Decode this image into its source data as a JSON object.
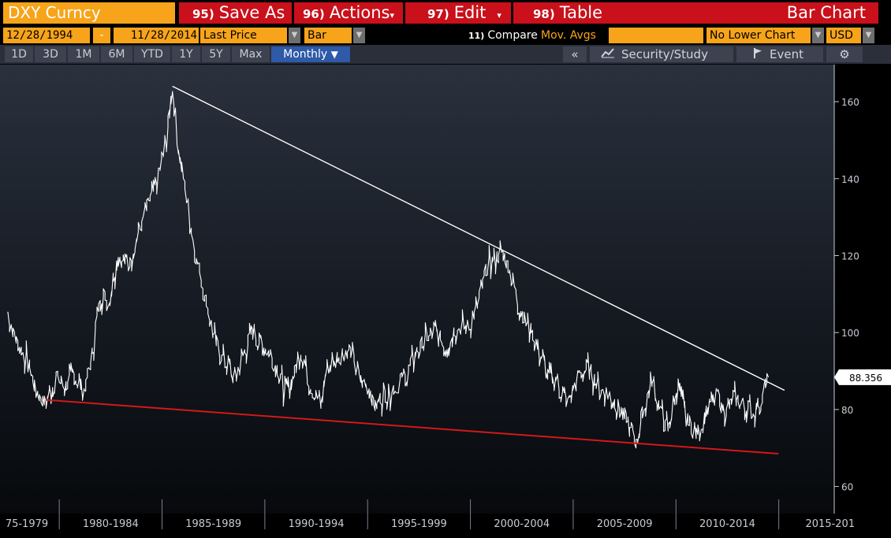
{
  "toolbar": {
    "ticker": "DXY Curncy",
    "save_as": {
      "num": "95)",
      "label": "Save As"
    },
    "actions": {
      "num": "96)",
      "label": "Actions"
    },
    "edit": {
      "num": "97)",
      "label": "Edit"
    },
    "table": {
      "num": "98)",
      "label": "Table"
    },
    "chart_type": "Bar Chart"
  },
  "params": {
    "start_date": "12/28/1994",
    "dash": "-",
    "end_date": "11/28/2014",
    "price_field": "Last Price",
    "style": "Bar",
    "compare_num": "11)",
    "compare": "Compare",
    "mov_avgs": "Mov. Avgs",
    "lower_chart": "No Lower Chart",
    "currency": "USD"
  },
  "periods": [
    "1D",
    "3D",
    "1M",
    "6M",
    "YTD",
    "1Y",
    "5Y",
    "Max"
  ],
  "frequency": "Monthly",
  "tools": {
    "collapse": "«",
    "security_study": "Security/Study",
    "event": "Event"
  },
  "chart_data": {
    "type": "bar",
    "title": "",
    "xlabel": "",
    "ylabel": "",
    "ylim": [
      55,
      168
    ],
    "y_ticks": [
      60,
      80,
      100,
      120,
      140,
      160
    ],
    "x_ticks": [
      "75-1979",
      "1980-1984",
      "1985-1989",
      "1990-1994",
      "1995-1999",
      "2000-2004",
      "2005-2009",
      "2010-2014",
      "2015-201"
    ],
    "x_range": [
      1977.0,
      2015.9
    ],
    "last_price_label": "88.356",
    "series": [
      {
        "points": [
          [
            1977.0,
            105
          ],
          [
            1977.5,
            97
          ],
          [
            1978.0,
            92
          ],
          [
            1978.4,
            85
          ],
          [
            1978.9,
            82
          ],
          [
            1979.4,
            88
          ],
          [
            1979.9,
            86
          ],
          [
            1980.3,
            89
          ],
          [
            1980.8,
            85
          ],
          [
            1981.2,
            94
          ],
          [
            1981.6,
            110
          ],
          [
            1982.0,
            108
          ],
          [
            1982.5,
            120
          ],
          [
            1983.0,
            118
          ],
          [
            1983.5,
            126
          ],
          [
            1984.0,
            133
          ],
          [
            1984.5,
            140
          ],
          [
            1984.9,
            150
          ],
          [
            1985.2,
            164
          ],
          [
            1985.5,
            148
          ],
          [
            1985.9,
            135
          ],
          [
            1986.3,
            122
          ],
          [
            1986.8,
            110
          ],
          [
            1987.3,
            98
          ],
          [
            1987.9,
            92
          ],
          [
            1988.3,
            88
          ],
          [
            1988.8,
            95
          ],
          [
            1989.2,
            101
          ],
          [
            1989.6,
            97
          ],
          [
            1990.0,
            95
          ],
          [
            1990.5,
            90
          ],
          [
            1990.8,
            84
          ],
          [
            1991.2,
            88
          ],
          [
            1991.6,
            96
          ],
          [
            1992.0,
            88
          ],
          [
            1992.6,
            81
          ],
          [
            1992.9,
            91
          ],
          [
            1993.5,
            94
          ],
          [
            1994.0,
            96
          ],
          [
            1994.5,
            88
          ],
          [
            1995.0,
            86
          ],
          [
            1995.3,
            81
          ],
          [
            1995.8,
            84
          ],
          [
            1996.3,
            86
          ],
          [
            1996.8,
            88
          ],
          [
            1997.3,
            94
          ],
          [
            1997.8,
            98
          ],
          [
            1998.3,
            100
          ],
          [
            1998.8,
            96
          ],
          [
            1999.4,
            102
          ],
          [
            1999.9,
            101
          ],
          [
            2000.4,
            107
          ],
          [
            2000.9,
            117
          ],
          [
            2001.3,
            119
          ],
          [
            2001.6,
            121
          ],
          [
            2002.0,
            117
          ],
          [
            2002.4,
            108
          ],
          [
            2002.9,
            102
          ],
          [
            2003.4,
            96
          ],
          [
            2003.9,
            89
          ],
          [
            2004.3,
            88
          ],
          [
            2004.9,
            81
          ],
          [
            2005.4,
            88
          ],
          [
            2005.9,
            91
          ],
          [
            2006.4,
            86
          ],
          [
            2006.9,
            84
          ],
          [
            2007.4,
            81
          ],
          [
            2007.9,
            76
          ],
          [
            2008.3,
            72
          ],
          [
            2008.7,
            80
          ],
          [
            2009.1,
            88
          ],
          [
            2009.6,
            78
          ],
          [
            2009.9,
            75
          ],
          [
            2010.4,
            87
          ],
          [
            2010.8,
            77
          ],
          [
            2011.3,
            74
          ],
          [
            2011.8,
            79
          ],
          [
            2012.3,
            83
          ],
          [
            2012.8,
            80
          ],
          [
            2013.3,
            83
          ],
          [
            2013.8,
            80
          ],
          [
            2014.3,
            80
          ],
          [
            2014.6,
            83
          ],
          [
            2014.9,
            88.4
          ]
        ]
      }
    ],
    "trendlines": [
      {
        "color": "#ffffff",
        "from": [
          1985.2,
          164
        ],
        "to": [
          2015.7,
          85
        ]
      },
      {
        "color": "#d21919",
        "from": [
          1978.9,
          82.5
        ],
        "to": [
          2015.4,
          68.5
        ]
      }
    ],
    "grid": false,
    "background": "#0b0d10",
    "line_color": "#ffffff",
    "axis_color": "#c8ccd4"
  }
}
